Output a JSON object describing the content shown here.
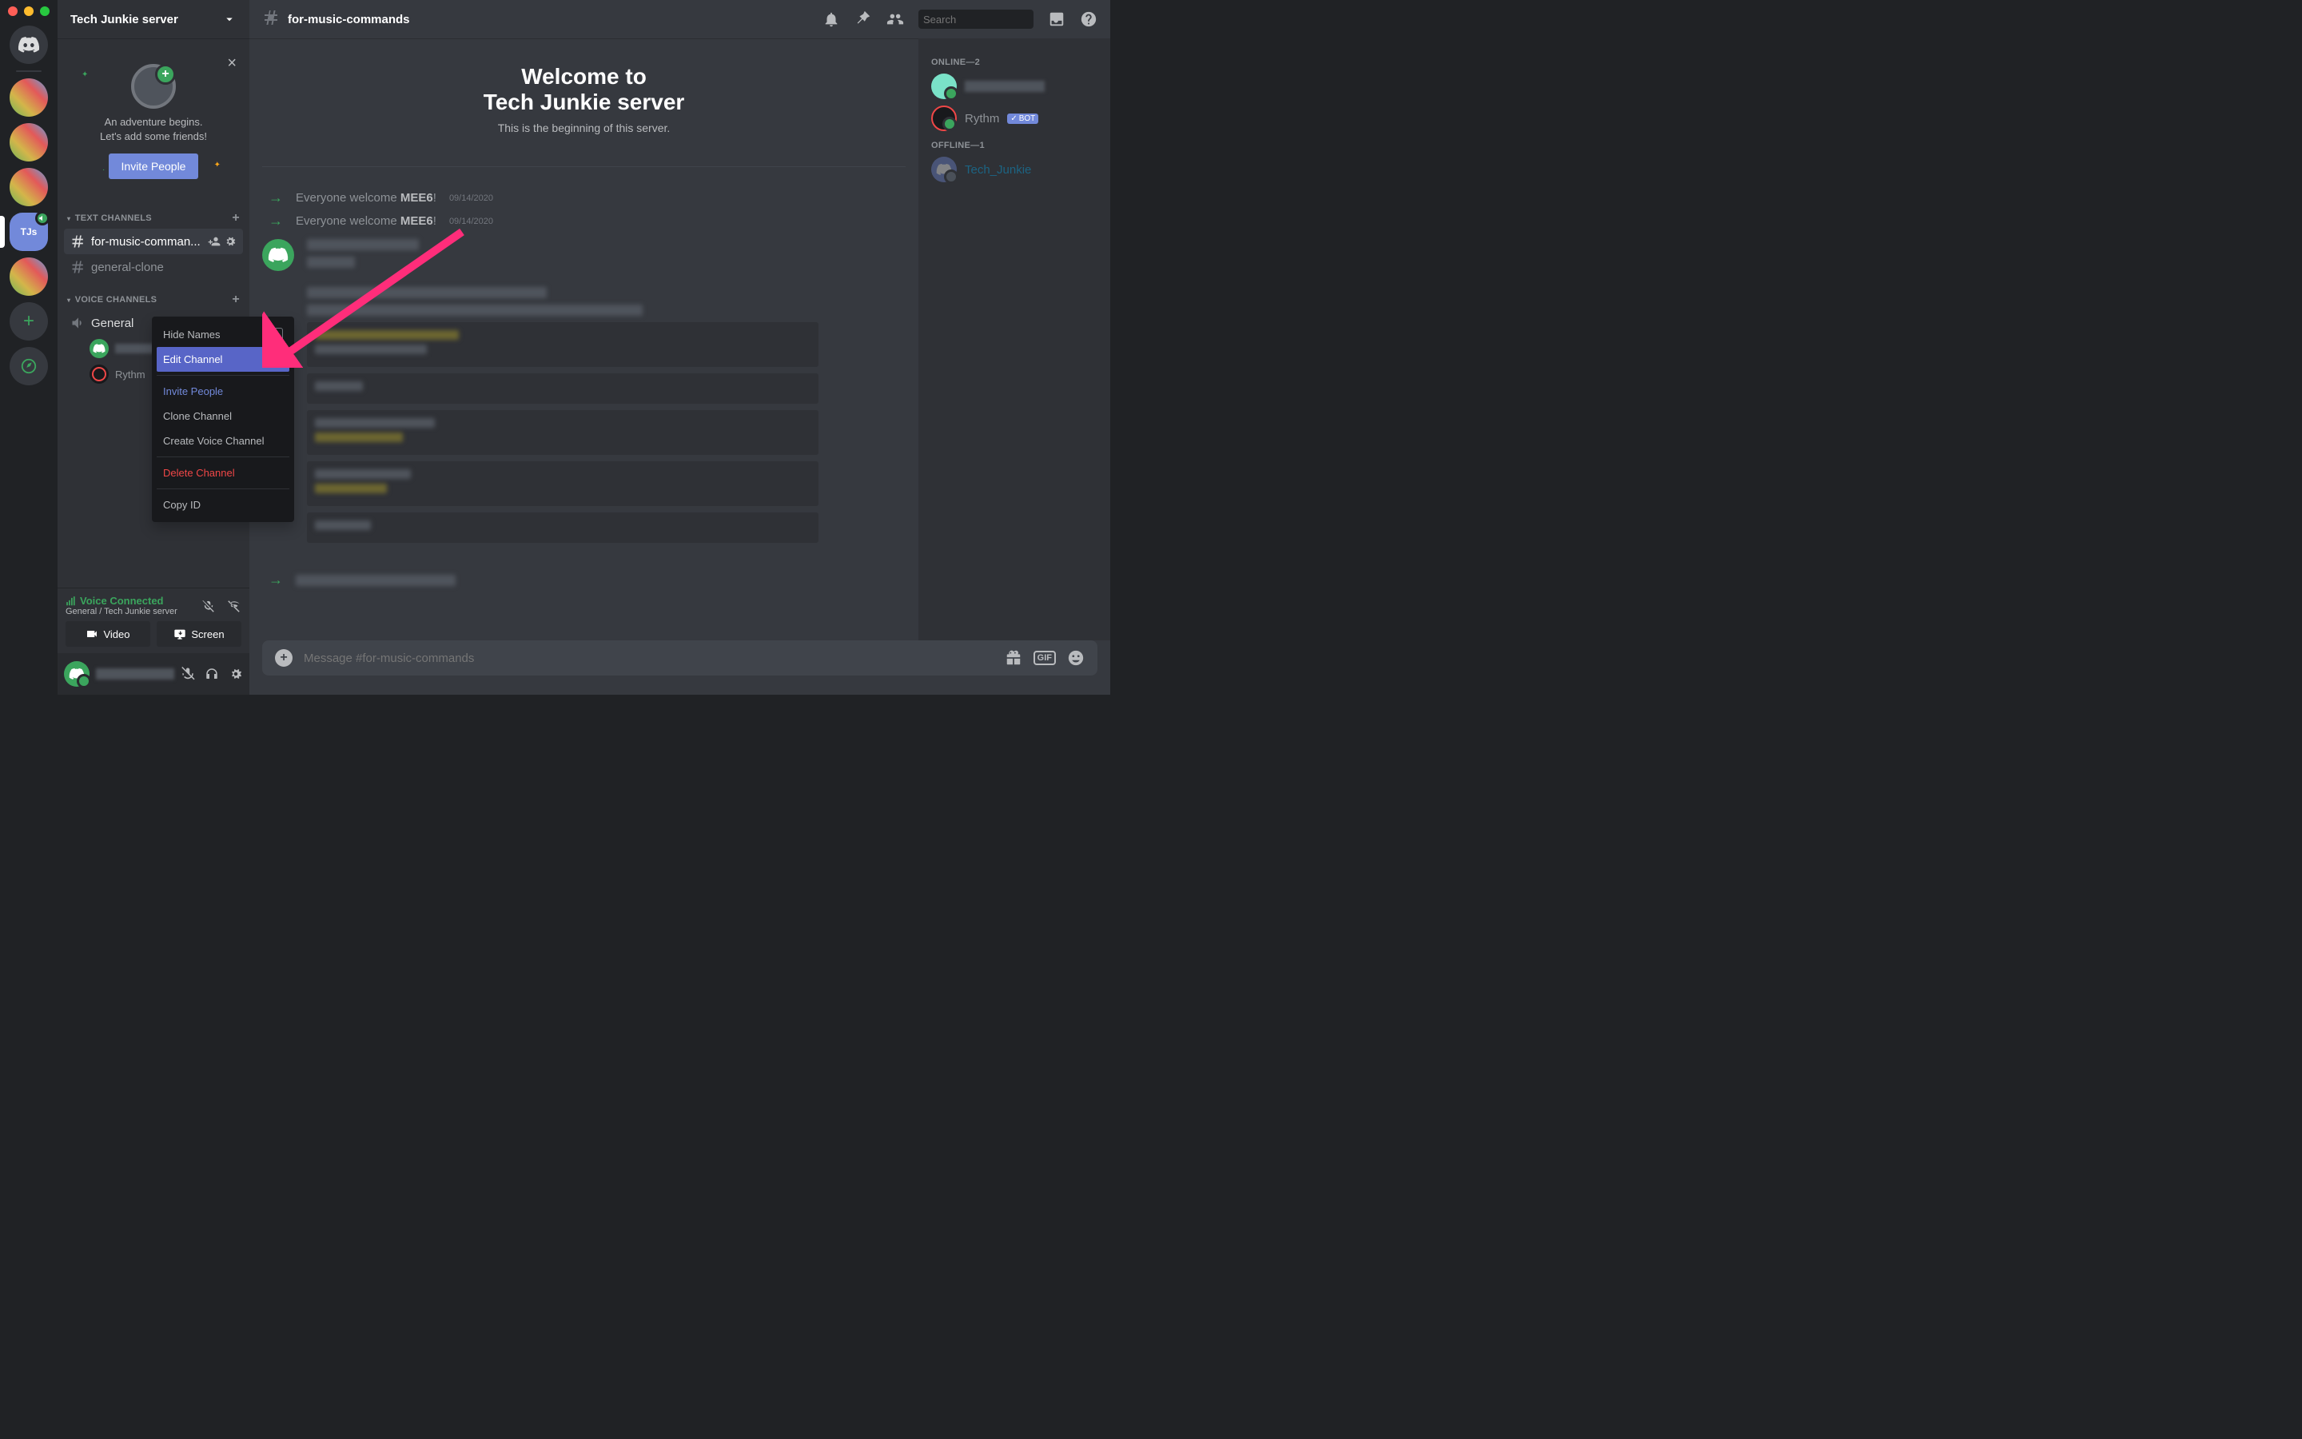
{
  "server": {
    "name": "Tech Junkie server",
    "selected_label": "TJs"
  },
  "invite_card": {
    "line1": "An adventure begins.",
    "line2": "Let's add some friends!",
    "button": "Invite People"
  },
  "categories": {
    "text": {
      "label": "TEXT CHANNELS",
      "channels": [
        {
          "name": "for-music-comman...",
          "active": true
        },
        {
          "name": "general-clone",
          "active": false
        }
      ]
    },
    "voice": {
      "label": "VOICE CHANNELS",
      "channels": [
        {
          "name": "General",
          "users": [
            {
              "name": ""
            },
            {
              "name": "Rythm"
            }
          ]
        }
      ]
    }
  },
  "voice_panel": {
    "status": "Voice Connected",
    "sub": "General / Tech Junkie server",
    "video": "Video",
    "screen": "Screen"
  },
  "topbar": {
    "channel": "for-music-commands",
    "search_placeholder": "Search"
  },
  "welcome": {
    "line1": "Welcome to",
    "line2": "Tech Junkie server",
    "sub": "This is the beginning of this server."
  },
  "system_messages": [
    {
      "prefix": "Everyone welcome ",
      "user": "MEE6",
      "suffix": "!",
      "date": "09/14/2020"
    },
    {
      "prefix": "Everyone welcome ",
      "user": "MEE6",
      "suffix": "!",
      "date": "09/14/2020"
    }
  ],
  "composer": {
    "placeholder": "Message #for-music-commands"
  },
  "members": {
    "online": {
      "label": "ONLINE—2",
      "list": [
        {
          "name": "",
          "bot": false
        },
        {
          "name": "Rythm",
          "bot": true
        }
      ]
    },
    "offline": {
      "label": "OFFLINE—1",
      "list": [
        {
          "name": "Tech_Junkie",
          "bot": false
        }
      ]
    }
  },
  "context_menu": {
    "hide_names": "Hide Names",
    "edit_channel": "Edit Channel",
    "invite_people": "Invite People",
    "clone_channel": "Clone Channel",
    "create_voice": "Create Voice Channel",
    "delete_channel": "Delete Channel",
    "copy_id": "Copy ID"
  },
  "bot_tag": "BOT"
}
